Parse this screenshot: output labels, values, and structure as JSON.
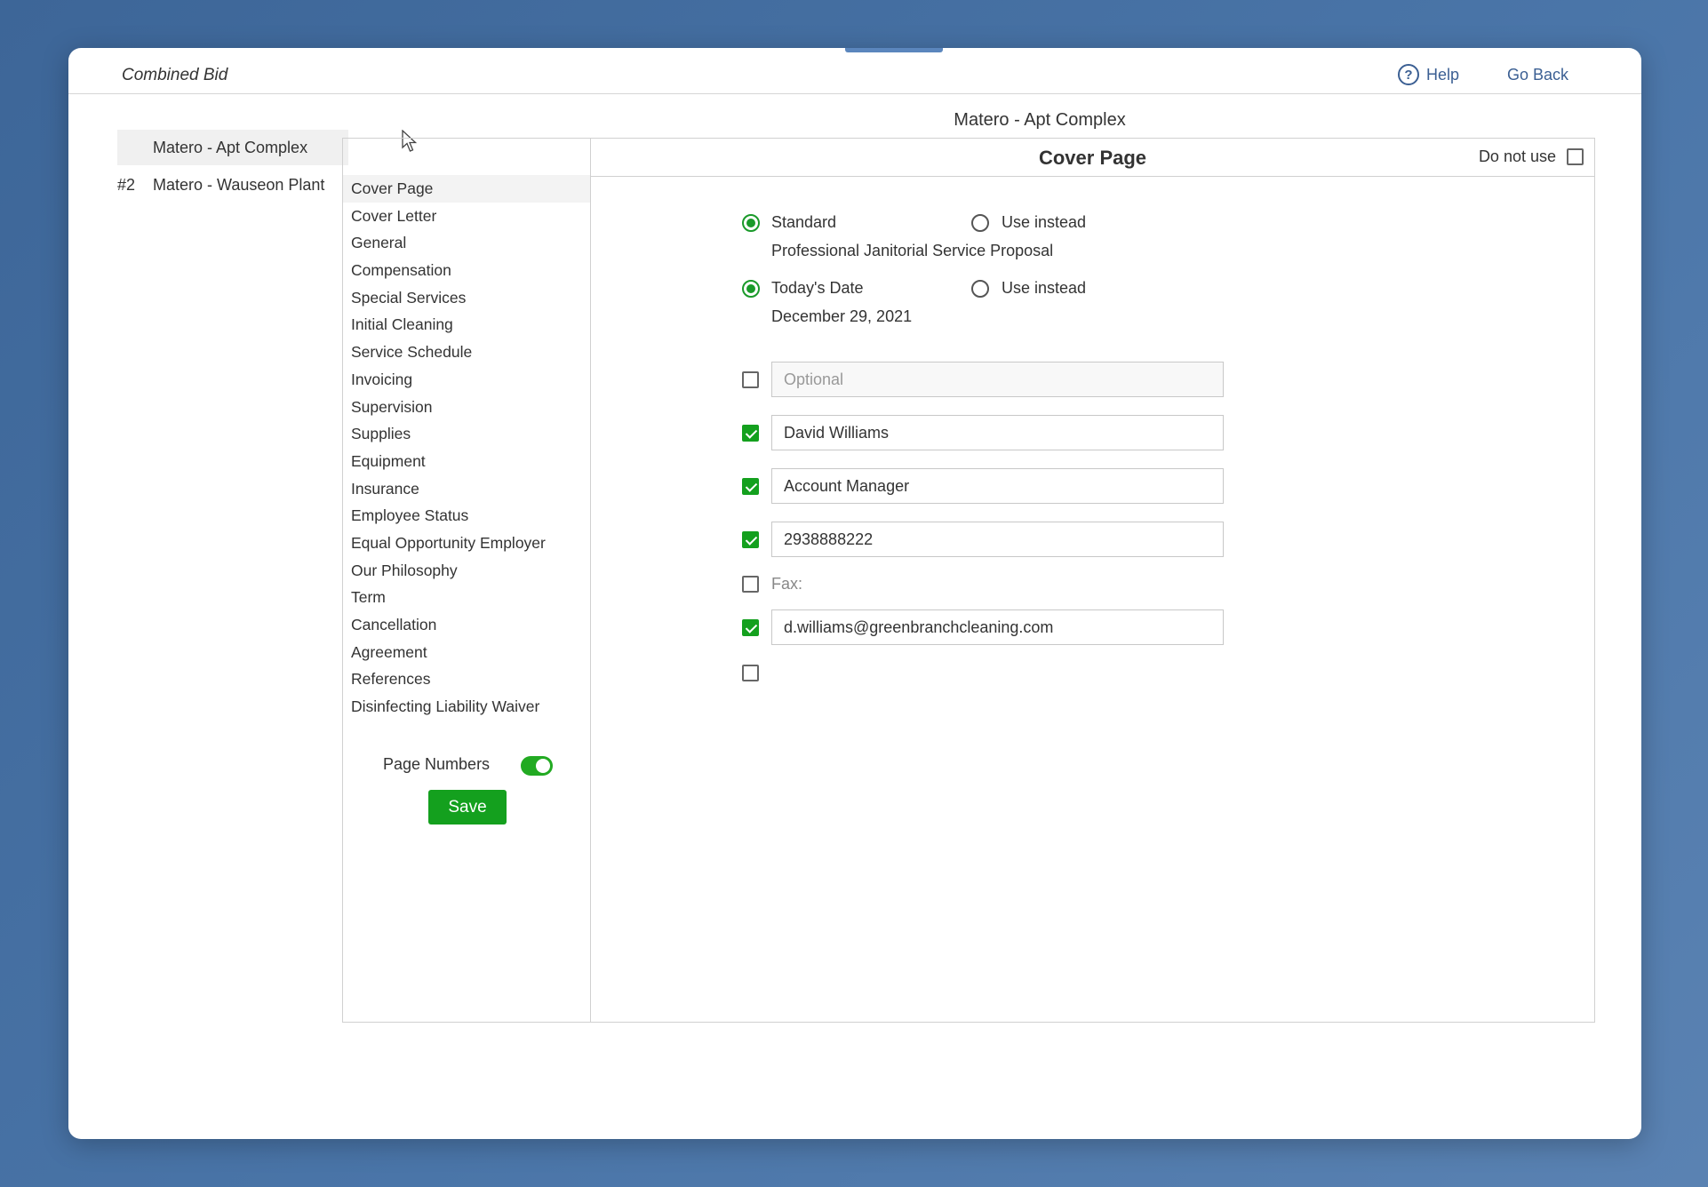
{
  "header": {
    "app_title": "Combined Bid",
    "help_label": "Help",
    "go_back_label": "Go Back"
  },
  "bids": [
    {
      "num": "",
      "name": "Matero - Apt Complex",
      "active": true
    },
    {
      "num": "#2",
      "name": "Matero - Wauseon Plant",
      "active": false
    }
  ],
  "property_title": "Matero - Apt Complex",
  "sections": [
    "Cover Page",
    "Cover Letter",
    "General",
    "Compensation",
    "Special Services",
    "Initial Cleaning",
    "Service Schedule",
    "Invoicing",
    "Supervision",
    "Supplies",
    "Equipment",
    "Insurance",
    "Employee Status",
    "Equal Opportunity Employer",
    "Our Philosophy",
    "Term",
    "Cancellation",
    "Agreement",
    "References",
    "Disinfecting Liability Waiver"
  ],
  "active_section": "Cover Page",
  "page_numbers": {
    "label": "Page Numbers",
    "enabled": true
  },
  "save_label": "Save",
  "content": {
    "title": "Cover Page",
    "do_not_use_label": "Do not use",
    "do_not_use_checked": false,
    "title_option": {
      "standard_label": "Standard",
      "use_instead_label": "Use instead",
      "selected": "standard",
      "standard_value": "Professional Janitorial Service Proposal"
    },
    "date_option": {
      "today_label": "Today's Date",
      "use_instead_label": "Use instead",
      "selected": "today",
      "today_value": "December 29, 2021"
    },
    "fields": {
      "optional": {
        "checked": false,
        "value": "",
        "placeholder": "Optional"
      },
      "name": {
        "checked": true,
        "value": "David Williams"
      },
      "job_title": {
        "checked": true,
        "value": "Account Manager"
      },
      "phone": {
        "checked": true,
        "value": "2938888222"
      },
      "fax": {
        "checked": false,
        "label": "Fax:"
      },
      "email": {
        "checked": true,
        "value": "d.williams@greenbranchcleaning.com"
      },
      "extra": {
        "checked": false
      }
    }
  },
  "colors": {
    "accent_green": "#14a01e",
    "link_blue": "#3b5f93",
    "desktop_blue": "#4a75a8"
  }
}
